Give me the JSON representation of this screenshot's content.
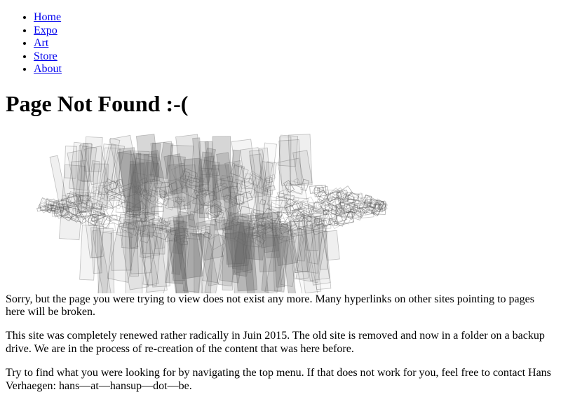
{
  "nav": {
    "items": [
      {
        "label": "Home"
      },
      {
        "label": "Expo"
      },
      {
        "label": "Art"
      },
      {
        "label": "Store"
      },
      {
        "label": "About"
      }
    ]
  },
  "main": {
    "title": "Page Not Found :-(",
    "paragraphs": [
      "Sorry, but the page you were trying to view does not exist any more. Many hyperlinks on other sites pointing to pages here will be broken.",
      "This site was completely renewed rather radically in Juin 2015. The old site is removed and now in a folder on a backup drive. We are in the process of re-creation of the content that was here before.",
      "Try to find what you were looking for by navigating the top menu. If that does not work for you, feel free to contact Hans Verhaegen: hans—at—hansup—dot—be."
    ]
  },
  "colors": {
    "link": "#0000ee",
    "text": "#000000",
    "sketch_stroke": "#555555",
    "sketch_fill": "#6a6a6a"
  }
}
